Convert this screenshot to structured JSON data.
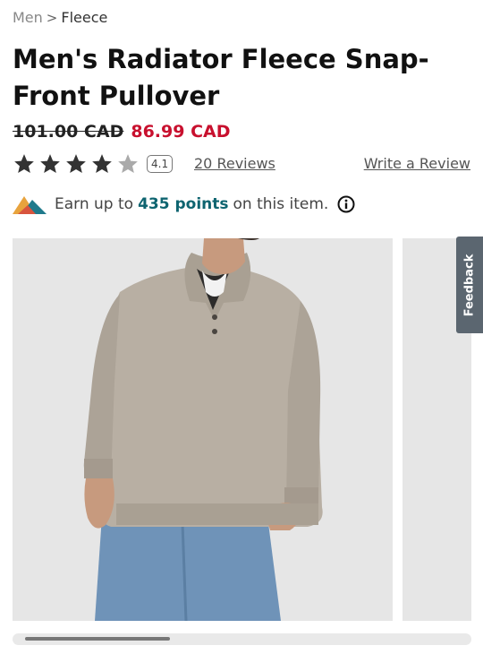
{
  "breadcrumb": {
    "parent": "Men",
    "separator": ">",
    "current": "Fleece"
  },
  "product": {
    "title": "Men's Radiator Fleece Snap-Front Pullover",
    "old_price": "101.00 CAD",
    "sale_price": "86.99 CAD",
    "rating_value": "4.1",
    "rating_stars": 4.1,
    "reviews_link": "20 Reviews",
    "write_review_link": "Write a Review"
  },
  "rewards": {
    "prefix": "Earn up to",
    "points": "435 points",
    "suffix": "on this item."
  },
  "feedback_tab": "Feedback",
  "colors": {
    "sale_price": "#c8102e",
    "points_accent": "#0e6470",
    "feedback_tab": "#5b6670",
    "image_bg": "#e6e6e6"
  },
  "icons": [
    "star-icon",
    "mountain-logo-icon",
    "info-icon",
    "chevron-right-icon"
  ],
  "gallery": {
    "scroll_position": 0.3
  }
}
